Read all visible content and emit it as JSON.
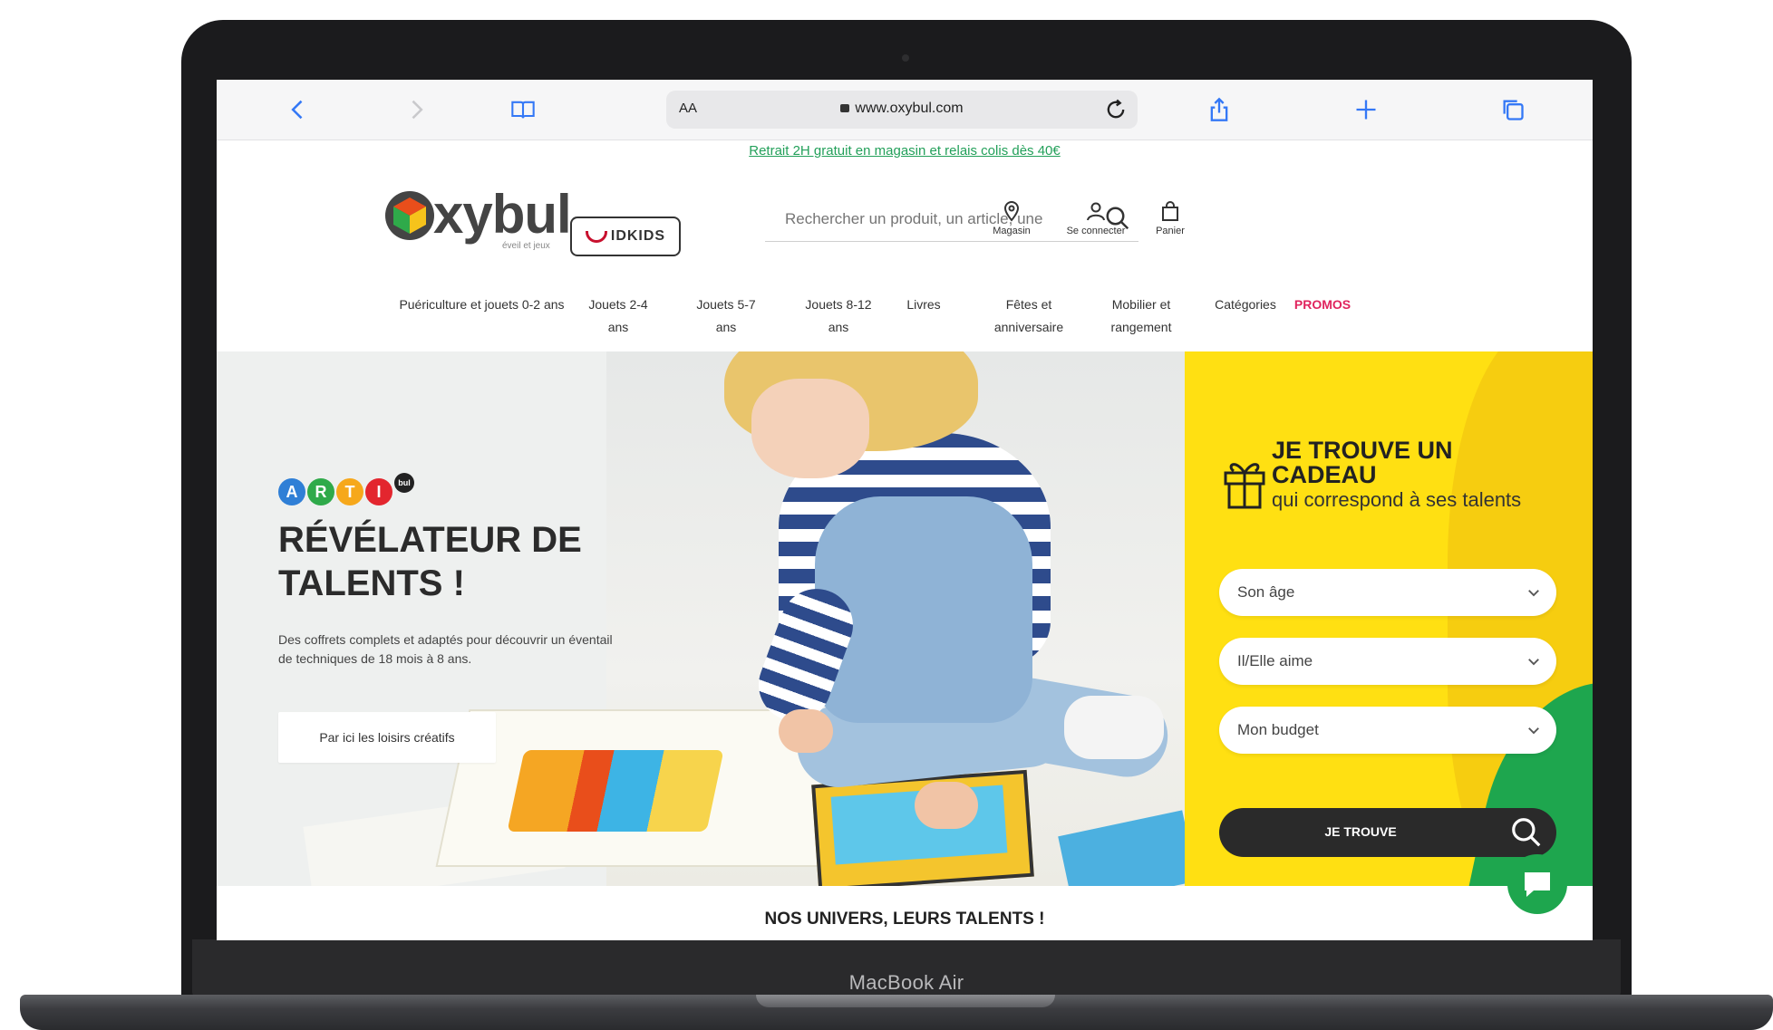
{
  "device": {
    "model_label": "MacBook Air"
  },
  "browser": {
    "text_size_button": "AA",
    "url": "www.oxybul.com",
    "icons": [
      "chevron-left-icon",
      "chevron-right-icon",
      "book-icon",
      "lock-icon",
      "reload-icon",
      "share-icon",
      "plus-icon",
      "tabs-icon"
    ],
    "accent_color": "#3478f6"
  },
  "site": {
    "promo_banner": "Retrait 2H gratuit en magasin et relais colis dès 40€",
    "logo": {
      "word": "xybul",
      "tagline": "éveil et jeux",
      "partner_badge": "IDKIDS"
    },
    "search": {
      "placeholder": "Rechercher un produit, un article, une"
    },
    "header_actions": {
      "store": "Magasin",
      "login": "Se connecter",
      "cart": "Panier"
    },
    "nav": [
      {
        "label": "Puériculture et jouets 0-2 ans"
      },
      {
        "label": "Jouets 2-4 ans"
      },
      {
        "label": "Jouets 5-7 ans"
      },
      {
        "label": "Jouets 8-12 ans"
      },
      {
        "label": "Livres"
      },
      {
        "label": "Fêtes et anniversaire"
      },
      {
        "label": "Mobilier et rangement"
      },
      {
        "label": "Catégories"
      },
      {
        "label": "PROMOS"
      }
    ],
    "hero": {
      "arti_letters": [
        "A",
        "R",
        "T",
        "I"
      ],
      "arti_suffix": "bul",
      "title": "RÉVÉLATEUR DE TALENTS !",
      "subtitle": "Des coffrets complets et adaptés pour découvrir un éventail de techniques de 18 mois à 8 ans.",
      "cta": "Par ici les loisirs créatifs"
    },
    "gift_finder": {
      "heading": "JE TROUVE UN CADEAU",
      "subheading": "qui correspond à ses talents",
      "selects": [
        {
          "label": "Son âge"
        },
        {
          "label": "Il/Elle aime"
        },
        {
          "label": "Mon budget"
        }
      ],
      "submit": "JE TROUVE",
      "colors": {
        "panel": "#ffe012",
        "button": "#2a2a2a",
        "accent_green": "#1ea64e"
      }
    },
    "section_title": "NOS UNIVERS, LEURS TALENTS !",
    "colors": {
      "promo_text": "#23a05a",
      "promo_nav": "#e0245e"
    }
  }
}
